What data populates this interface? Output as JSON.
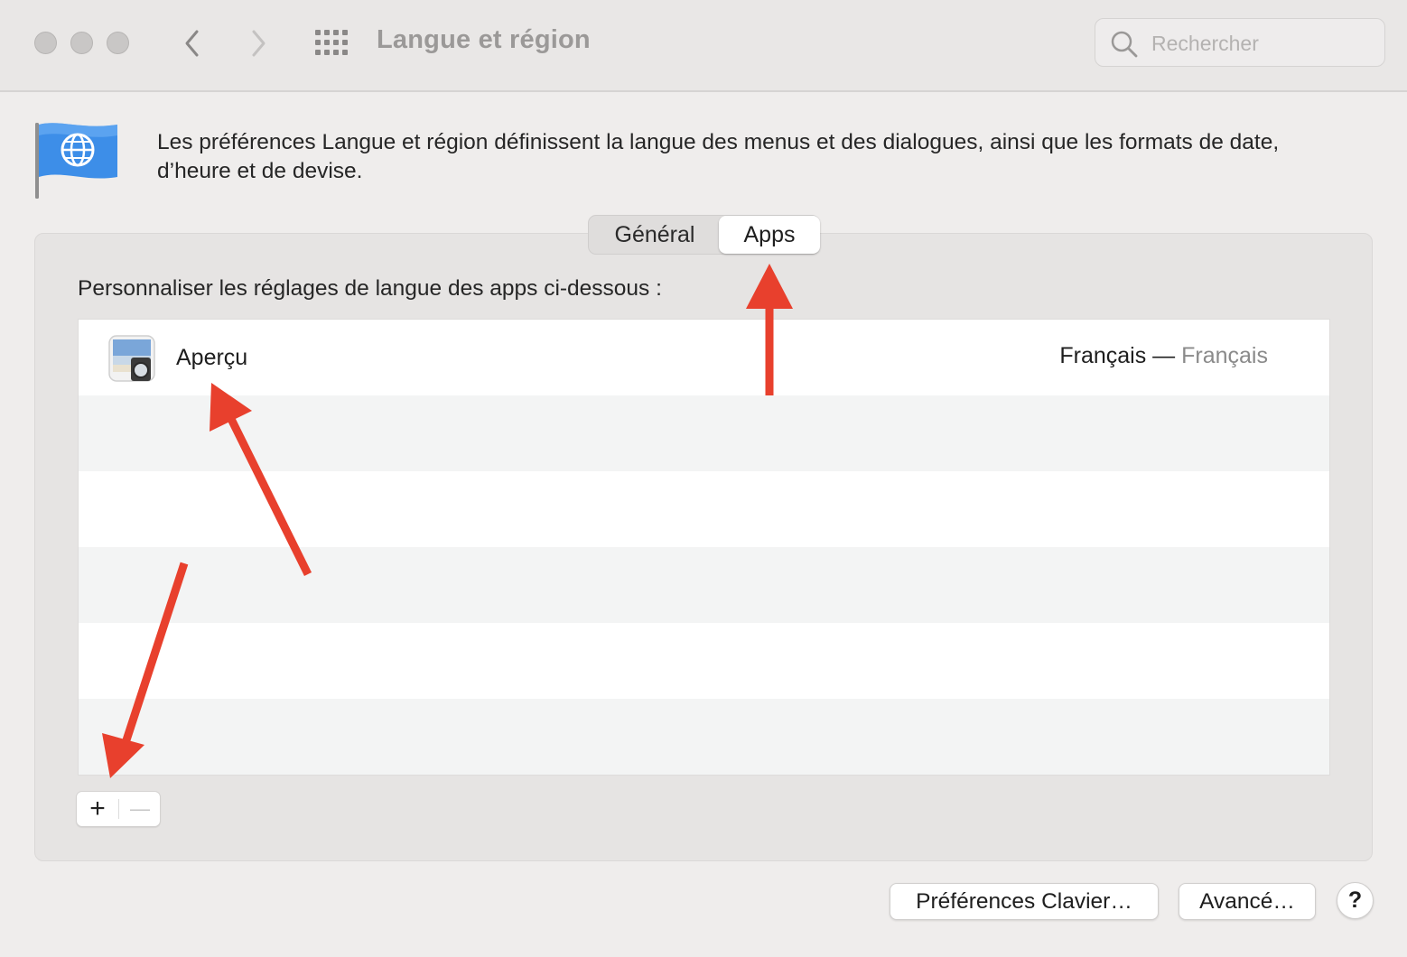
{
  "window": {
    "title": "Langue et région",
    "search_placeholder": "Rechercher"
  },
  "header": {
    "description": "Les préférences Langue et région définissent la langue des menus et des dialogues, ainsi que les formats de date, d’heure et de devise."
  },
  "tabs": [
    {
      "label": "Général",
      "selected": false
    },
    {
      "label": "Apps",
      "selected": true
    }
  ],
  "apps_panel": {
    "label": "Personnaliser les réglages de langue des apps ci-dessous :",
    "rows": [
      {
        "name": "Aperçu",
        "language": "Français",
        "separator": " — ",
        "language_native": "Français"
      }
    ],
    "add_symbol": "+",
    "remove_symbol": "—"
  },
  "buttons": {
    "keyboard_prefs": "Préférences Clavier…",
    "advanced": "Avancé…",
    "help": "?"
  },
  "colors": {
    "annotation_arrow": "#e8402d",
    "accent_flag": "#3d8ee8"
  }
}
